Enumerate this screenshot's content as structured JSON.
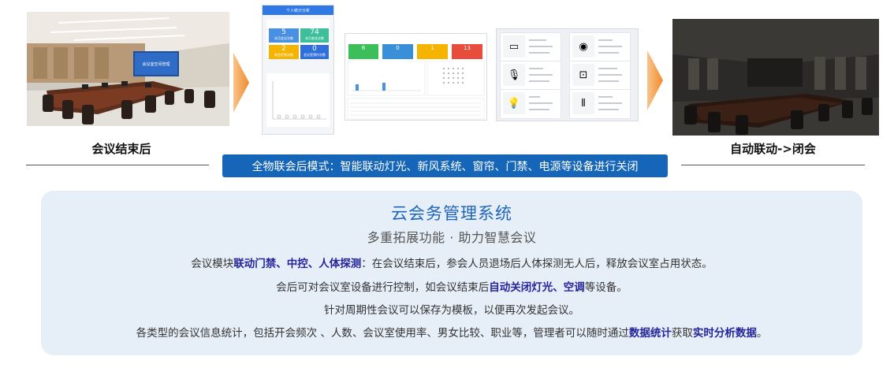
{
  "captions": {
    "left": "会议结束后",
    "right": "自动联动->闭会"
  },
  "banner": "全物联会后模式：智能联动灯光、新风系统、窗帘、门禁、电源等设备进行关闭",
  "projector_screen_text": "会议室空间管理",
  "phone_screen": {
    "title": "个人统计分析",
    "tiles": [
      {
        "value": "5",
        "label": "本月会议次数",
        "color": "#4a90e2"
      },
      {
        "value": "74",
        "label": "本月参会次数",
        "color": "#3cbf9a"
      },
      {
        "value": "2",
        "label": "参会迟到次数",
        "color": "#f5b400"
      },
      {
        "value": "0",
        "label": "会议室预约次数",
        "color": "#2f6fdc"
      }
    ]
  },
  "dashboard_screen": {
    "stats": [
      {
        "value": "6",
        "color": "#3cbf5a"
      },
      {
        "value": "0",
        "color": "#3a8fd9"
      },
      {
        "value": "1",
        "color": "#f5b400"
      },
      {
        "value": "13",
        "color": "#e84c3d"
      }
    ]
  },
  "panel": {
    "title": "云会务管理系统",
    "subtitle": "多重拓展功能 · 助力智慧会议",
    "line1": {
      "a": "会议模块",
      "b": "联动门禁、中控、人体探测",
      "c": "：在会议结束后，参会人员退场后人体探测无人后，释放会议室占用状态。"
    },
    "line2": {
      "a": "会后可对会议室设备进行控制，如会议结束后",
      "b": "自动关闭灯光、空调",
      "c": "等设备。"
    },
    "line3": "针对周期性会议可以保存为模板，以便再次发起会议。",
    "line4": {
      "a": "各类型的会议信息统计，包括开会频次 、人数、会议室使用率、男女比较、职业等，管理者可以随时通过",
      "b": "数据统计",
      "c": "获取",
      "d": "实时分析数据",
      "e": "。"
    }
  }
}
